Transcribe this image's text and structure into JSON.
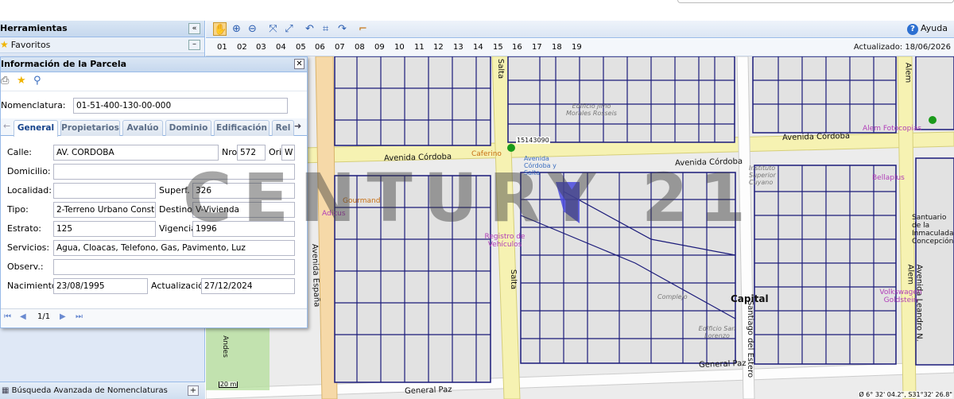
{
  "left_panel": {
    "title": "Herramientas",
    "favorites": "Favoritos",
    "advanced_search": "Búsqueda Avanzada de Nomenclaturas"
  },
  "parcel_window": {
    "title": "Información de la Parcela",
    "nomenclatura_label": "Nomenclatura:",
    "nomenclatura": "01-51-400-130-00-000",
    "tabs": [
      "General",
      "Propietarios",
      "Avalúo",
      "Dominio",
      "Edificación",
      "Rel"
    ],
    "fields": {
      "calle_label": "Calle:",
      "calle": "AV. CORDOBA",
      "nro_label": "Nro",
      "nro": "572",
      "ori_label": "Ori",
      "ori": "W",
      "domicilio_label": "Domicilio:",
      "domicilio": "",
      "localidad_label": "Localidad:",
      "localidad": "",
      "superf_label": "Superf.",
      "superf": "326",
      "tipo_label": "Tipo:",
      "tipo": "2-Terreno Urbano Constru",
      "destino_label": "Destino",
      "destino": "V-Vivienda",
      "estrato_label": "Estrato:",
      "estrato": "125",
      "vigencia_label": "Vigencia",
      "vigencia": "1996",
      "servicios_label": "Servicios:",
      "servicios": "Agua, Cloacas, Telefono, Gas, Pavimento, Luz",
      "observ_label": "Observ.:",
      "observ": "",
      "nacimiento_label": "Nacimiento:",
      "nacimiento": "23/08/1995",
      "actualizacion_label": "Actualización",
      "actualizacion": "27/12/2024"
    },
    "pager": "1/1"
  },
  "map_toolbar": {
    "help": "Ayuda"
  },
  "hours_bar": {
    "hours": [
      "01",
      "02",
      "03",
      "04",
      "05",
      "06",
      "07",
      "08",
      "09",
      "10",
      "11",
      "12",
      "13",
      "14",
      "15",
      "16",
      "17",
      "18",
      "19"
    ],
    "updated": "Actualizado: 18/06/2026"
  },
  "map": {
    "labels": {
      "av_cordoba": "Avenida Córdoba",
      "general_paz": "General Paz",
      "av_espana": "Avenida España",
      "salta": "Salta",
      "santiago_del_estero": "Santiago del Estero",
      "av_leandro_alem": "Avenida Leandro N. Alem",
      "alem": "Alem",
      "andes": "Andes",
      "capital": "Capital",
      "edificio_jimo": "Edificio Jimo Morales Rosseis",
      "alem_fotocopias": "Alem Fotocopias",
      "instituto": "Instituto Superior Cuyano",
      "caferino": "Caferino",
      "av_cordoba_salta": "Avenida Córdoba y Salta",
      "gourmand": "Gourmand",
      "adicus": "Adicus",
      "registro": "Registro de Vehículos",
      "complejo": "Complejo",
      "edificio_sl": "Edificio San Lorenzo",
      "santuario": "Santuario de la Inmaculada Concepción",
      "volkswagen": "Volkswagen Goldstein",
      "bellaplus": "Bellaplus",
      "stop_code": "15143090",
      "scale": "20 m",
      "coords": "Ø 6° 32' 04.2\", S31°32' 26.8\""
    },
    "watermark": "CENTURY 21"
  }
}
